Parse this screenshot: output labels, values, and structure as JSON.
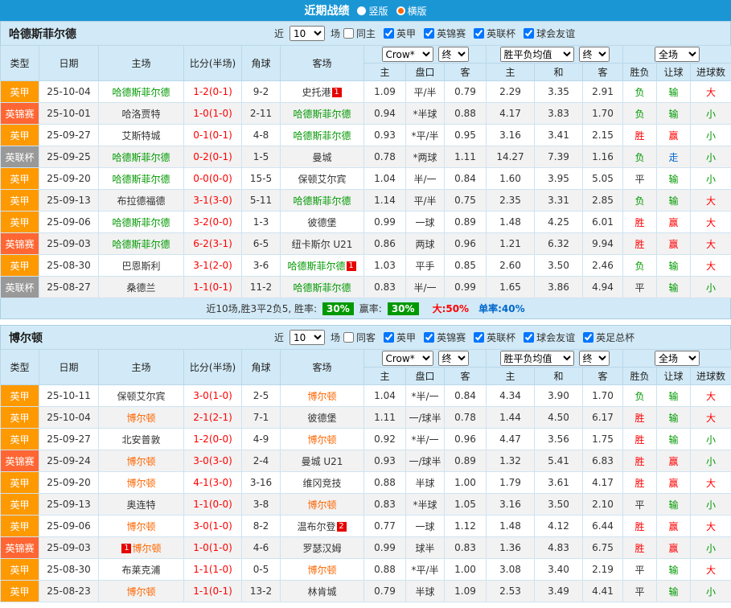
{
  "topbar": {
    "title": "近期战绩",
    "vertical_label": "竖版",
    "horizontal_label": "横版"
  },
  "colors": {
    "league": {
      "英甲": "#ff9900",
      "英锦赛": "#ff6633",
      "英联杯": "#999999"
    },
    "team": {
      "focus_green": "#009900",
      "focus_orange": "#ff6600",
      "normal": "#333333"
    },
    "value": {
      "red": "#ff0000",
      "green": "#009900",
      "blue": "#0066cc",
      "black": "#333333"
    },
    "badge_bg": "#e60000",
    "rate_badge_bg": "#009900",
    "topbar_bg": "#1a96d5",
    "header_bg": "#d2eaf7"
  },
  "table_headers": {
    "type": "类型",
    "date": "日期",
    "home": "主场",
    "score": "比分(半场)",
    "corner": "角球",
    "away": "客场",
    "odds": [
      "主",
      "盘口",
      "客"
    ],
    "avg": [
      "主",
      "和",
      "客"
    ],
    "result": "胜负",
    "let": "让球",
    "size": "进球数"
  },
  "sections": [
    {
      "team": "哈德斯菲尔德",
      "near": {
        "prefix": "近",
        "value": "10",
        "suffix": "场"
      },
      "checkboxes": [
        {
          "label": "同主",
          "checked": false
        },
        {
          "label": "英甲",
          "checked": true
        },
        {
          "label": "英锦赛",
          "checked": true
        },
        {
          "label": "英联杯",
          "checked": true
        },
        {
          "label": "球会友谊",
          "checked": true
        }
      ],
      "selects": {
        "bookmaker": "Crow*",
        "odds_time": "终",
        "metric": "胜平负均值",
        "metric_time": "终",
        "scope": "全场"
      },
      "rows": [
        {
          "league": "英甲",
          "date": "25-10-04",
          "home": {
            "name": "哈德斯菲尔德",
            "focus": 1
          },
          "score": "1-2(0-1)",
          "corner": "9-2",
          "away": {
            "name": "史托港",
            "badge": "1"
          },
          "oh": "1.09",
          "hc": "平/半",
          "oa": "0.79",
          "ah": "2.29",
          "ad": "3.35",
          "aa": "2.91",
          "res": [
            "负",
            "green"
          ],
          "let": [
            "输",
            "green"
          ],
          "size": [
            "大",
            "red"
          ]
        },
        {
          "league": "英锦赛",
          "date": "25-10-01",
          "home": {
            "name": "哈洛贾特"
          },
          "score": "1-0(1-0)",
          "corner": "2-11",
          "away": {
            "name": "哈德斯菲尔德",
            "focus": 1
          },
          "oh": "0.94",
          "hc": "*半球",
          "oa": "0.88",
          "ah": "4.17",
          "ad": "3.83",
          "aa": "1.70",
          "res": [
            "负",
            "green"
          ],
          "let": [
            "输",
            "green"
          ],
          "size": [
            "小",
            "green"
          ]
        },
        {
          "league": "英甲",
          "date": "25-09-27",
          "home": {
            "name": "艾斯特城"
          },
          "score": "0-1(0-1)",
          "corner": "4-8",
          "away": {
            "name": "哈德斯菲尔德",
            "focus": 1
          },
          "oh": "0.93",
          "hc": "*平/半",
          "oa": "0.95",
          "ah": "3.16",
          "ad": "3.41",
          "aa": "2.15",
          "res": [
            "胜",
            "red"
          ],
          "let": [
            "赢",
            "red"
          ],
          "size": [
            "小",
            "green"
          ]
        },
        {
          "league": "英联杯",
          "date": "25-09-25",
          "home": {
            "name": "哈德斯菲尔德",
            "focus": 1
          },
          "score": "0-2(0-1)",
          "corner": "1-5",
          "away": {
            "name": "曼城"
          },
          "oh": "0.78",
          "hc": "*两球",
          "oa": "1.11",
          "ah": "14.27",
          "ad": "7.39",
          "aa": "1.16",
          "res": [
            "负",
            "green"
          ],
          "let": [
            "走",
            "blue"
          ],
          "size": [
            "小",
            "green"
          ]
        },
        {
          "league": "英甲",
          "date": "25-09-20",
          "home": {
            "name": "哈德斯菲尔德",
            "focus": 1
          },
          "score": "0-0(0-0)",
          "corner": "15-5",
          "away": {
            "name": "保顿艾尔宾"
          },
          "oh": "1.04",
          "hc": "半/一",
          "oa": "0.84",
          "ah": "1.60",
          "ad": "3.95",
          "aa": "5.05",
          "res": [
            "平",
            "black"
          ],
          "let": [
            "输",
            "green"
          ],
          "size": [
            "小",
            "green"
          ]
        },
        {
          "league": "英甲",
          "date": "25-09-13",
          "home": {
            "name": "布拉德福德"
          },
          "score": "3-1(3-0)",
          "corner": "5-11",
          "away": {
            "name": "哈德斯菲尔德",
            "focus": 1
          },
          "oh": "1.14",
          "hc": "平/半",
          "oa": "0.75",
          "ah": "2.35",
          "ad": "3.31",
          "aa": "2.85",
          "res": [
            "负",
            "green"
          ],
          "let": [
            "输",
            "green"
          ],
          "size": [
            "大",
            "red"
          ]
        },
        {
          "league": "英甲",
          "date": "25-09-06",
          "home": {
            "name": "哈德斯菲尔德",
            "focus": 1
          },
          "score": "3-2(0-0)",
          "corner": "1-3",
          "away": {
            "name": "彼德堡"
          },
          "oh": "0.99",
          "hc": "一球",
          "oa": "0.89",
          "ah": "1.48",
          "ad": "4.25",
          "aa": "6.01",
          "res": [
            "胜",
            "red"
          ],
          "let": [
            "赢",
            "red"
          ],
          "size": [
            "大",
            "red"
          ]
        },
        {
          "league": "英锦赛",
          "date": "25-09-03",
          "home": {
            "name": "哈德斯菲尔德",
            "focus": 1
          },
          "score": "6-2(3-1)",
          "corner": "6-5",
          "away": {
            "name": "纽卡斯尔 U21"
          },
          "oh": "0.86",
          "hc": "两球",
          "oa": "0.96",
          "ah": "1.21",
          "ad": "6.32",
          "aa": "9.94",
          "res": [
            "胜",
            "red"
          ],
          "let": [
            "赢",
            "red"
          ],
          "size": [
            "大",
            "red"
          ]
        },
        {
          "league": "英甲",
          "date": "25-08-30",
          "home": {
            "name": "巴恩斯利"
          },
          "score": "3-1(2-0)",
          "corner": "3-6",
          "away": {
            "name": "哈德斯菲尔德",
            "focus": 1,
            "badge": "1"
          },
          "oh": "1.03",
          "hc": "平手",
          "oa": "0.85",
          "ah": "2.60",
          "ad": "3.50",
          "aa": "2.46",
          "res": [
            "负",
            "green"
          ],
          "let": [
            "输",
            "green"
          ],
          "size": [
            "大",
            "red"
          ]
        },
        {
          "league": "英联杯",
          "date": "25-08-27",
          "home": {
            "name": "桑德兰"
          },
          "score": "1-1(0-1)",
          "corner": "11-2",
          "away": {
            "name": "哈德斯菲尔德",
            "focus": 1
          },
          "oh": "0.83",
          "hc": "半/一",
          "oa": "0.99",
          "ah": "1.65",
          "ad": "3.86",
          "aa": "4.94",
          "res": [
            "平",
            "black"
          ],
          "let": [
            "输",
            "green"
          ],
          "size": [
            "小",
            "green"
          ]
        }
      ],
      "summary": {
        "prefix": "近10场,胜3平2负5, 胜率:",
        "win_rate": "30%",
        "mid": "赢率:",
        "profit_rate": "30%",
        "big": "大:50%",
        "single": "单率:40%"
      }
    },
    {
      "team": "博尔顿",
      "near": {
        "prefix": "近",
        "value": "10",
        "suffix": "场"
      },
      "checkboxes": [
        {
          "label": "同客",
          "checked": false
        },
        {
          "label": "英甲",
          "checked": true
        },
        {
          "label": "英锦赛",
          "checked": true
        },
        {
          "label": "英联杯",
          "checked": true
        },
        {
          "label": "球会友谊",
          "checked": true
        },
        {
          "label": "英足总杯",
          "checked": true
        }
      ],
      "selects": {
        "bookmaker": "Crow*",
        "odds_time": "终",
        "metric": "胜平负均值",
        "metric_time": "终",
        "scope": "全场"
      },
      "rows": [
        {
          "league": "英甲",
          "date": "25-10-11",
          "home": {
            "name": "保顿艾尔宾"
          },
          "score": "3-0(1-0)",
          "corner": "2-5",
          "away": {
            "name": "博尔顿",
            "focus": 2
          },
          "oh": "1.04",
          "hc": "*半/一",
          "oa": "0.84",
          "ah": "4.34",
          "ad": "3.90",
          "aa": "1.70",
          "res": [
            "负",
            "green"
          ],
          "let": [
            "输",
            "green"
          ],
          "size": [
            "大",
            "red"
          ]
        },
        {
          "league": "英甲",
          "date": "25-10-04",
          "home": {
            "name": "博尔顿",
            "focus": 2
          },
          "score": "2-1(2-1)",
          "corner": "7-1",
          "away": {
            "name": "彼德堡"
          },
          "oh": "1.11",
          "hc": "一/球半",
          "oa": "0.78",
          "ah": "1.44",
          "ad": "4.50",
          "aa": "6.17",
          "res": [
            "胜",
            "red"
          ],
          "let": [
            "输",
            "green"
          ],
          "size": [
            "大",
            "red"
          ]
        },
        {
          "league": "英甲",
          "date": "25-09-27",
          "home": {
            "name": "北安普敦"
          },
          "score": "1-2(0-0)",
          "corner": "4-9",
          "away": {
            "name": "博尔顿",
            "focus": 2
          },
          "oh": "0.92",
          "hc": "*半/一",
          "oa": "0.96",
          "ah": "4.47",
          "ad": "3.56",
          "aa": "1.75",
          "res": [
            "胜",
            "red"
          ],
          "let": [
            "输",
            "green"
          ],
          "size": [
            "小",
            "green"
          ]
        },
        {
          "league": "英锦赛",
          "date": "25-09-24",
          "home": {
            "name": "博尔顿",
            "focus": 2
          },
          "score": "3-0(3-0)",
          "corner": "2-4",
          "away": {
            "name": "曼城 U21"
          },
          "oh": "0.93",
          "hc": "一/球半",
          "oa": "0.89",
          "ah": "1.32",
          "ad": "5.41",
          "aa": "6.83",
          "res": [
            "胜",
            "red"
          ],
          "let": [
            "赢",
            "red"
          ],
          "size": [
            "小",
            "green"
          ]
        },
        {
          "league": "英甲",
          "date": "25-09-20",
          "home": {
            "name": "博尔顿",
            "focus": 2
          },
          "score": "4-1(3-0)",
          "corner": "3-16",
          "away": {
            "name": "维冈竞技"
          },
          "oh": "0.88",
          "hc": "半球",
          "oa": "1.00",
          "ah": "1.79",
          "ad": "3.61",
          "aa": "4.17",
          "res": [
            "胜",
            "red"
          ],
          "let": [
            "赢",
            "red"
          ],
          "size": [
            "大",
            "red"
          ]
        },
        {
          "league": "英甲",
          "date": "25-09-13",
          "home": {
            "name": "奥连特"
          },
          "score": "1-1(0-0)",
          "corner": "3-8",
          "away": {
            "name": "博尔顿",
            "focus": 2
          },
          "oh": "0.83",
          "hc": "*半球",
          "oa": "1.05",
          "ah": "3.16",
          "ad": "3.50",
          "aa": "2.10",
          "res": [
            "平",
            "black"
          ],
          "let": [
            "输",
            "green"
          ],
          "size": [
            "小",
            "green"
          ]
        },
        {
          "league": "英甲",
          "date": "25-09-06",
          "home": {
            "name": "博尔顿",
            "focus": 2
          },
          "score": "3-0(1-0)",
          "corner": "8-2",
          "away": {
            "name": "温布尔登",
            "badge": "2"
          },
          "oh": "0.77",
          "hc": "一球",
          "oa": "1.12",
          "ah": "1.48",
          "ad": "4.12",
          "aa": "6.44",
          "res": [
            "胜",
            "red"
          ],
          "let": [
            "赢",
            "red"
          ],
          "size": [
            "大",
            "red"
          ]
        },
        {
          "league": "英锦赛",
          "date": "25-09-03",
          "home": {
            "name": "博尔顿",
            "focus": 2,
            "badge": "1",
            "badge_side": "before"
          },
          "score": "1-0(1-0)",
          "corner": "4-6",
          "away": {
            "name": "罗瑟汉姆"
          },
          "oh": "0.99",
          "hc": "球半",
          "oa": "0.83",
          "ah": "1.36",
          "ad": "4.83",
          "aa": "6.75",
          "res": [
            "胜",
            "red"
          ],
          "let": [
            "赢",
            "red"
          ],
          "size": [
            "小",
            "green"
          ]
        },
        {
          "league": "英甲",
          "date": "25-08-30",
          "home": {
            "name": "布莱克浦"
          },
          "score": "1-1(1-0)",
          "corner": "0-5",
          "away": {
            "name": "博尔顿",
            "focus": 2
          },
          "oh": "0.88",
          "hc": "*平/半",
          "oa": "1.00",
          "ah": "3.08",
          "ad": "3.40",
          "aa": "2.19",
          "res": [
            "平",
            "black"
          ],
          "let": [
            "输",
            "green"
          ],
          "size": [
            "大",
            "red"
          ]
        },
        {
          "league": "英甲",
          "date": "25-08-23",
          "home": {
            "name": "博尔顿",
            "focus": 2
          },
          "score": "1-1(0-1)",
          "corner": "13-2",
          "away": {
            "name": "林肯城"
          },
          "oh": "0.79",
          "hc": "半球",
          "oa": "1.09",
          "ah": "2.53",
          "ad": "3.49",
          "aa": "4.41",
          "res": [
            "平",
            "black"
          ],
          "let": [
            "输",
            "green"
          ],
          "size": [
            "小",
            "green"
          ]
        }
      ],
      "summary": null
    }
  ]
}
